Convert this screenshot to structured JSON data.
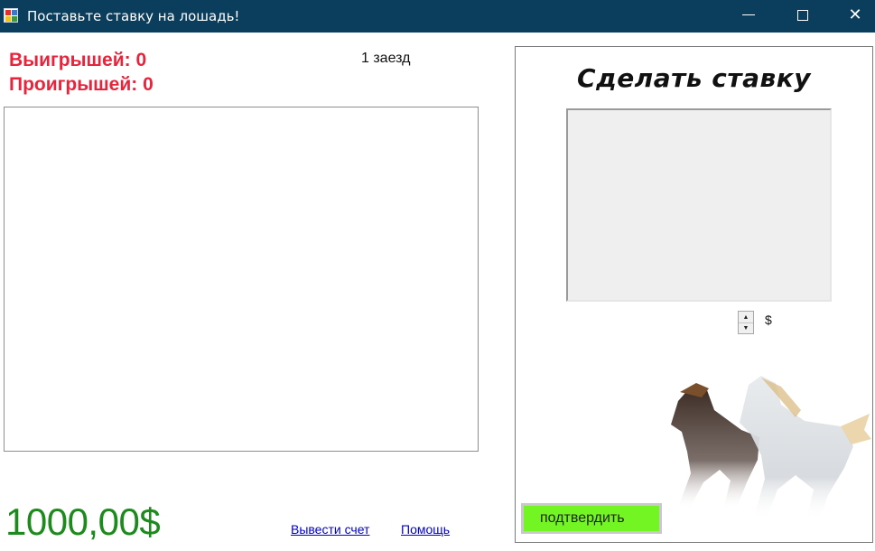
{
  "window": {
    "title": "Поставьте ставку на лошадь!",
    "minimize_icon": "minimize-icon",
    "maximize_icon": "maximize-icon",
    "close_icon": "close-icon",
    "close_glyph": "✕",
    "titlebar_color": "#0b3d5c"
  },
  "stats": {
    "wins_label": "Выигрышей: 0",
    "losses_label": "Проигрышей: 0",
    "color": "#e8243c"
  },
  "race": {
    "label": "1 заезд"
  },
  "balance": {
    "amount": "1000,00$",
    "color": "#1c8a1c"
  },
  "links": {
    "withdraw": "Вывести счет",
    "help": "Помощь"
  },
  "bet_panel": {
    "title": "Сделать ставку",
    "currency": "$",
    "confirm_label": "подтвердить",
    "confirm_color": "#73f523",
    "image_icon": "horses-image"
  }
}
